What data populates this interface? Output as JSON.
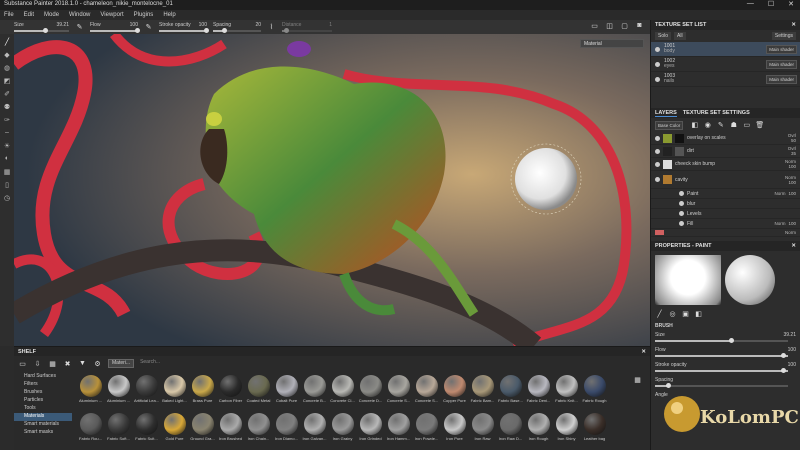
{
  "window": {
    "title": "Substance Painter 2018.1.0 - chameleon_nikie_montelocne_01",
    "buttons": [
      "—",
      "☐",
      "✕"
    ]
  },
  "menu": [
    "File",
    "Edit",
    "Mode",
    "Window",
    "Viewport",
    "Plugins",
    "Help"
  ],
  "toolbar": {
    "size_label": "Size",
    "size_value": "39.21",
    "flow_label": "Flow",
    "flow_value": "100",
    "stroke_opacity_label": "Stroke opacity",
    "stroke_opacity_value": "100",
    "spacing_label": "Spacing",
    "spacing_value": "20",
    "distance_label": "Distance",
    "distance_value": "1"
  },
  "viewport": {
    "material_select": "Material"
  },
  "texture_set_list": {
    "title": "TEXTURE SET LIST",
    "solo_label": "Solo",
    "all_label": "All",
    "settings_label": "Settings",
    "items": [
      {
        "name": "1001",
        "sub": "body",
        "shader": "Main shader"
      },
      {
        "name": "1002",
        "sub": "eyes",
        "shader": "Main shader"
      },
      {
        "name": "1003",
        "sub": "nails",
        "shader": "Main shader"
      }
    ]
  },
  "layers": {
    "tab_layers": "LAYERS",
    "tab_tss": "TEXTURE SET SETTINGS",
    "channel": "Base Color",
    "rows": [
      {
        "name": "overlay on scales",
        "blend": "Ovrl",
        "opacity": "50"
      },
      {
        "name": "dirt",
        "blend": "Ovrl",
        "opacity": "35"
      },
      {
        "name": "cheeck skin bump",
        "blend": "Norm",
        "opacity": "100"
      },
      {
        "name": "cavity",
        "blend": "Norm",
        "opacity": "100"
      },
      {
        "name": "Paint",
        "blend": "Norm",
        "opacity": "100"
      },
      {
        "name": "blur",
        "blend": "",
        "opacity": ""
      },
      {
        "name": "Levels",
        "blend": "",
        "opacity": ""
      },
      {
        "name": "Fill",
        "blend": "Norm",
        "opacity": "100"
      },
      {
        "name": "",
        "blend": "Norm",
        "opacity": ""
      }
    ]
  },
  "properties": {
    "title": "PROPERTIES - PAINT",
    "brush_title": "BRUSH",
    "size_label": "Size",
    "size_value": "39.21",
    "flow_label": "Flow",
    "flow_value": "100",
    "stroke_label": "Stroke opacity",
    "stroke_value": "100",
    "spacing_label": "Spacing",
    "angle_label": "Angle"
  },
  "shelf": {
    "title": "SHELF",
    "filter_tag": "Materi...",
    "search_placeholder": "Search...",
    "categories": [
      "Hard Surfaces",
      "Filters",
      "Brushes",
      "Particles",
      "Tools",
      "Materials",
      "Smart materials",
      "Smart masks"
    ],
    "selected_category": "Materials",
    "row1": [
      {
        "name": "Aluminium ...",
        "color": "#b8913a"
      },
      {
        "name": "Aluminium ...",
        "color": "#c8c8c8"
      },
      {
        "name": "Artificial Lea...",
        "color": "#3a3a3a"
      },
      {
        "name": "Baked Light...",
        "color": "#d9c8a8"
      },
      {
        "name": "Brass Pure",
        "color": "#c9a84a"
      },
      {
        "name": "Carbon Fiber",
        "color": "#2a2a2a"
      },
      {
        "name": "Coated Metal",
        "color": "#6a6a50"
      },
      {
        "name": "Cobalt Pure",
        "color": "#b0b0b8"
      },
      {
        "name": "Concrete B...",
        "color": "#9a9a96"
      },
      {
        "name": "Concrete Cl...",
        "color": "#b8b8b4"
      },
      {
        "name": "Concrete D...",
        "color": "#8a8a86"
      },
      {
        "name": "Concrete S...",
        "color": "#a8a6a0"
      },
      {
        "name": "Concrete S...",
        "color": "#b8a898"
      },
      {
        "name": "Copper Pure",
        "color": "#c08a70"
      },
      {
        "name": "Fabric Bam...",
        "color": "#a89878"
      },
      {
        "name": "Fabric Base...",
        "color": "#4a5a6a"
      },
      {
        "name": "Fabric Deni...",
        "color": "#b8b8c0"
      },
      {
        "name": "Fabric Knit...",
        "color": "#c0c0c0"
      },
      {
        "name": "Fabric Rough",
        "color": "#3a4a6a"
      }
    ],
    "row2": [
      {
        "name": "Fabric Rou...",
        "color": "#5a5a5a"
      },
      {
        "name": "Fabric Soft...",
        "color": "#3a3a3a"
      },
      {
        "name": "Fabric Suit...",
        "color": "#2e2e2e"
      },
      {
        "name": "Gold Pure",
        "color": "#d8a838"
      },
      {
        "name": "Ground Gra...",
        "color": "#8a8470"
      },
      {
        "name": "Iron Brushed",
        "color": "#aaaaaa"
      },
      {
        "name": "Iron Chain...",
        "color": "#909090"
      },
      {
        "name": "Iron Diamo...",
        "color": "#808080"
      },
      {
        "name": "Iron Galvan...",
        "color": "#b0b0b0"
      },
      {
        "name": "Iron Grainy",
        "color": "#9a9a9a"
      },
      {
        "name": "Iron Grinded",
        "color": "#b8b8b8"
      },
      {
        "name": "Iron Hamm...",
        "color": "#a0a0a0"
      },
      {
        "name": "Iron Powde...",
        "color": "#7a7a7a"
      },
      {
        "name": "Iron Pure",
        "color": "#c8c8c8"
      },
      {
        "name": "Iron Raw",
        "color": "#8a8a8a"
      },
      {
        "name": "Iron Raw D...",
        "color": "#6a6a6a"
      },
      {
        "name": "Iron Rough",
        "color": "#b0b0b0"
      },
      {
        "name": "Iron Shiny",
        "color": "#d0d0d0"
      },
      {
        "name": "Leather bag",
        "color": "#3a2e28"
      }
    ]
  },
  "watermark": "KoLomPC"
}
